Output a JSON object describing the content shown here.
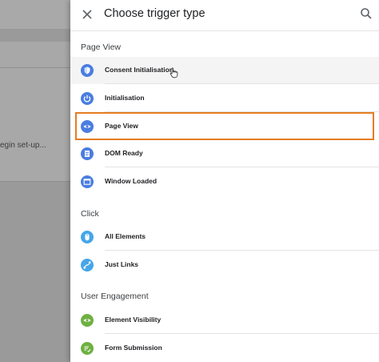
{
  "background": {
    "partial_text": "egin set-up..."
  },
  "panel": {
    "title": "Choose trigger type",
    "close_icon": "close-icon",
    "search_icon": "search-icon"
  },
  "sections": [
    {
      "label": "Page View",
      "items": [
        {
          "label": "Consent Initialisation",
          "icon": "shield-icon",
          "color": "#4a7de0"
        },
        {
          "label": "Initialisation",
          "icon": "power-icon",
          "color": "#4a7de0"
        },
        {
          "label": "Page View",
          "icon": "eye-icon",
          "color": "#4a7de0"
        },
        {
          "label": "DOM Ready",
          "icon": "document-icon",
          "color": "#4a7de0"
        },
        {
          "label": "Window Loaded",
          "icon": "window-icon",
          "color": "#4a7de0"
        }
      ]
    },
    {
      "label": "Click",
      "items": [
        {
          "label": "All Elements",
          "icon": "mouse-icon",
          "color": "#45a6e8"
        },
        {
          "label": "Just Links",
          "icon": "link-icon",
          "color": "#45a6e8"
        }
      ]
    },
    {
      "label": "User Engagement",
      "items": [
        {
          "label": "Element Visibility",
          "icon": "eye-icon",
          "color": "#6fb043"
        },
        {
          "label": "Form Submission",
          "icon": "form-icon",
          "color": "#6fb043"
        }
      ]
    }
  ],
  "highlight_color": "#e57d22"
}
